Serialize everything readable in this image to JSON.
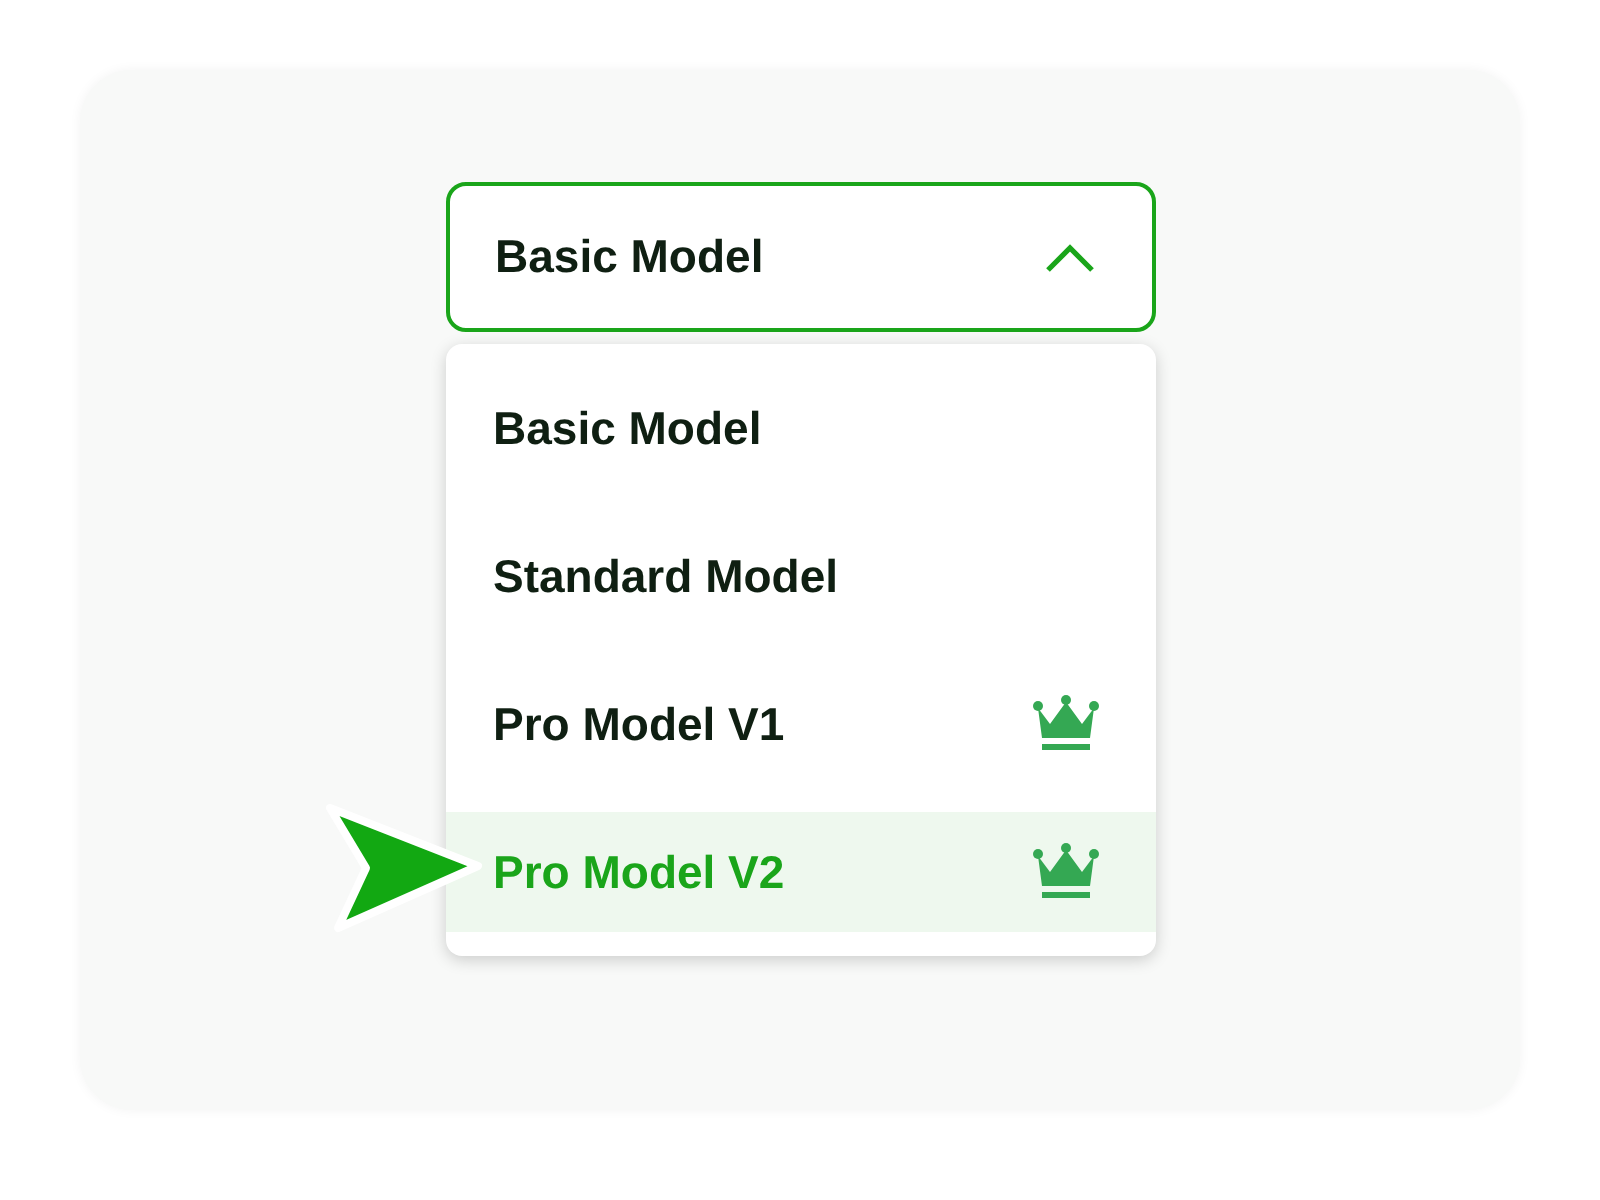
{
  "select": {
    "value": "Basic Model",
    "expanded": true
  },
  "options": [
    {
      "label": "Basic Model",
      "premium": false,
      "selected": false
    },
    {
      "label": "Standard Model",
      "premium": false,
      "selected": false
    },
    {
      "label": "Pro Model V1",
      "premium": true,
      "selected": false
    },
    {
      "label": "Pro Model V2",
      "premium": true,
      "selected": true
    }
  ]
}
